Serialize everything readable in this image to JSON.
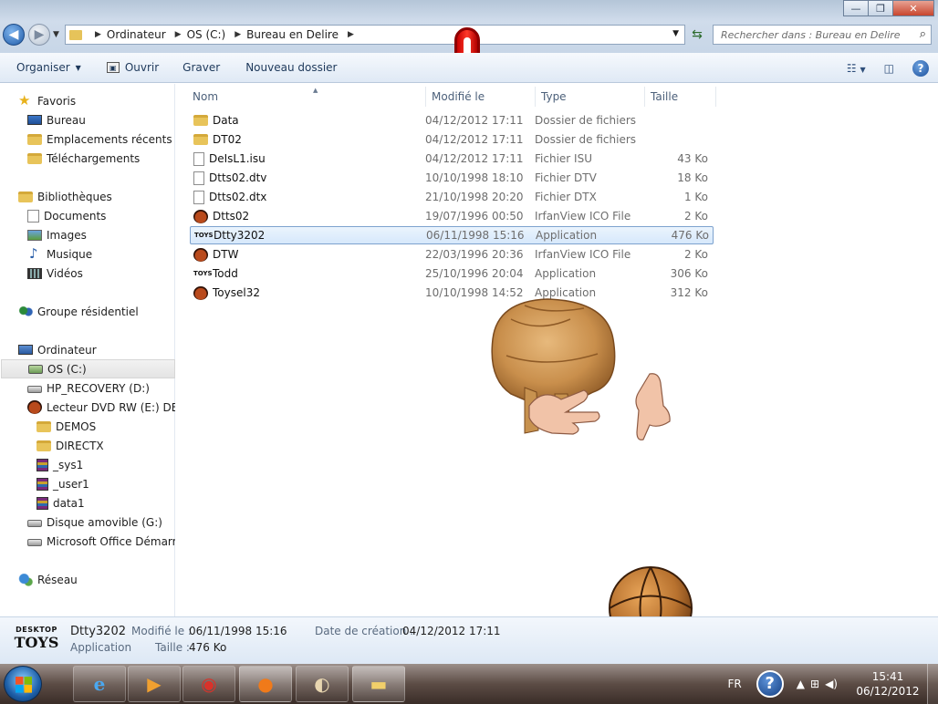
{
  "window": {
    "controls": {
      "minimize": "—",
      "maximize": "❐",
      "close": "✕"
    }
  },
  "address": {
    "crumbs": [
      "Ordinateur",
      "OS (C:)",
      "Bureau en Delire"
    ],
    "search_placeholder": "Rechercher dans : Bureau en Delire"
  },
  "toolbar": {
    "organize": "Organiser",
    "open": "Ouvrir",
    "burn": "Graver",
    "new_folder": "Nouveau dossier"
  },
  "sidebar": {
    "favorites": "Favoris",
    "desktop": "Bureau",
    "recent": "Emplacements récents",
    "downloads": "Téléchargements",
    "libraries": "Bibliothèques",
    "documents": "Documents",
    "images": "Images",
    "music": "Musique",
    "videos": "Vidéos",
    "homegroup": "Groupe résidentiel",
    "computer": "Ordinateur",
    "os_c": "OS (C:)",
    "hp_recovery": "HP_RECOVERY (D:)",
    "dvd": "Lecteur DVD RW (E:) DELIR",
    "demos": "DEMOS",
    "directx": "DIRECTX",
    "sys1": "_sys1",
    "user1": "_user1",
    "data1": "data1",
    "removable": "Disque amovible (G:)",
    "office": "Microsoft Office Démarrer",
    "network": "Réseau"
  },
  "columns": {
    "name": "Nom",
    "modified": "Modifié le",
    "type": "Type",
    "size": "Taille"
  },
  "files": [
    {
      "name": "Data",
      "modified": "04/12/2012 17:11",
      "type": "Dossier de fichiers",
      "size": "",
      "icon": "folder"
    },
    {
      "name": "DT02",
      "modified": "04/12/2012 17:11",
      "type": "Dossier de fichiers",
      "size": "",
      "icon": "folder"
    },
    {
      "name": "DeIsL1.isu",
      "modified": "04/12/2012 17:11",
      "type": "Fichier ISU",
      "size": "43 Ko",
      "icon": "file"
    },
    {
      "name": "Dtts02.dtv",
      "modified": "10/10/1998 18:10",
      "type": "Fichier DTV",
      "size": "18 Ko",
      "icon": "file"
    },
    {
      "name": "Dtts02.dtx",
      "modified": "21/10/1998 20:20",
      "type": "Fichier DTX",
      "size": "1 Ko",
      "icon": "file"
    },
    {
      "name": "Dtts02",
      "modified": "19/07/1996 00:50",
      "type": "IrfanView ICO File",
      "size": "2 Ko",
      "icon": "dtface"
    },
    {
      "name": "Dtty3202",
      "modified": "06/11/1998 15:16",
      "type": "Application",
      "size": "476 Ko",
      "icon": "toys"
    },
    {
      "name": "DTW",
      "modified": "22/03/1996 20:36",
      "type": "IrfanView ICO File",
      "size": "2 Ko",
      "icon": "dtface"
    },
    {
      "name": "Todd",
      "modified": "25/10/1996 20:04",
      "type": "Application",
      "size": "306 Ko",
      "icon": "toys"
    },
    {
      "name": "Toysel32",
      "modified": "10/10/1998 14:52",
      "type": "Application",
      "size": "312 Ko",
      "icon": "dtface"
    }
  ],
  "selected_index": 6,
  "details": {
    "logo_top": "DESKTOP",
    "logo_bottom": "TOYS",
    "name": "Dtty3202",
    "kind": "Application",
    "modified_label": "Modifié le :",
    "modified_value": "06/11/1998 15:16",
    "size_label": "Taille :",
    "size_value": "476 Ko",
    "created_label": "Date de création :",
    "created_value": "04/12/2012 17:11"
  },
  "taskbar": {
    "lang": "FR",
    "help": "?",
    "time": "15:41",
    "date": "06/12/2012"
  },
  "colors": {
    "accent": "#1f5ba8",
    "selection": "#d6e8fb",
    "taskbar": "#4a3b35"
  }
}
